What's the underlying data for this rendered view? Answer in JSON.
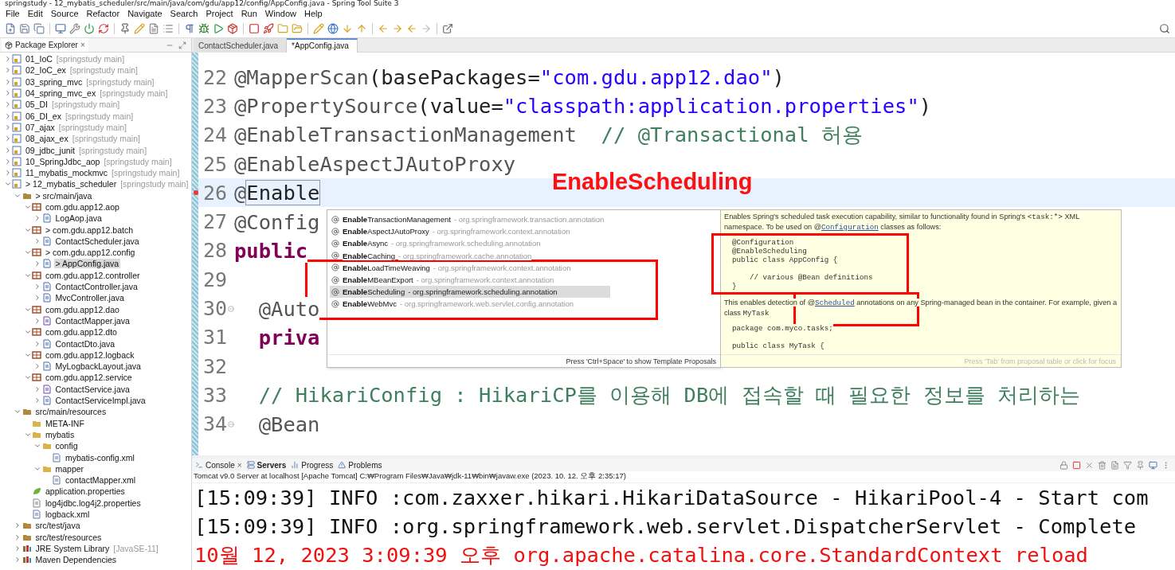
{
  "window": {
    "title": "springstudy - 12_mybatis_scheduler/src/main/java/com/gdu/app12/config/AppConfig.java - Spring Tool Suite 3"
  },
  "menu": [
    "File",
    "Edit",
    "Source",
    "Refactor",
    "Navigate",
    "Search",
    "Project",
    "Run",
    "Window",
    "Help"
  ],
  "explorer": {
    "tab": {
      "label": "Package Explorer",
      "close": "×"
    },
    "tree": [
      {
        "label": "01_IoC",
        "suffix": "[springstudy main]",
        "kind": "project",
        "expanded": false,
        "selected": false
      },
      {
        "label": "02_IoC_ex",
        "suffix": "[springstudy main]",
        "kind": "project",
        "expanded": false,
        "selected": false
      },
      {
        "label": "03_spring_mvc",
        "suffix": "[springstudy main]",
        "kind": "project",
        "expanded": false,
        "selected": false
      },
      {
        "label": "04_spring_mvc_ex",
        "suffix": "[springstudy main]",
        "kind": "project",
        "expanded": false,
        "selected": false
      },
      {
        "label": "05_DI",
        "suffix": "[springstudy main]",
        "kind": "project",
        "expanded": false,
        "selected": false
      },
      {
        "label": "06_DI_ex",
        "suffix": "[springstudy main]",
        "kind": "project",
        "expanded": false,
        "selected": false
      },
      {
        "label": "07_ajax",
        "suffix": "[springstudy main]",
        "kind": "project",
        "expanded": false,
        "selected": false
      },
      {
        "label": "08_ajax_ex",
        "suffix": "[springstudy main]",
        "kind": "project",
        "expanded": false,
        "selected": false
      },
      {
        "label": "09_jdbc_junit",
        "suffix": "[springstudy main]",
        "kind": "project",
        "expanded": false,
        "selected": false
      },
      {
        "label": "10_SpringJdbc_aop",
        "suffix": "[springstudy main]",
        "kind": "project",
        "expanded": false,
        "selected": false
      },
      {
        "label": "11_mybatis_mockmvc",
        "suffix": "[springstudy main]",
        "kind": "project",
        "expanded": false,
        "selected": false
      },
      {
        "label": "12_mybatis_scheduler",
        "decoration": ">",
        "suffix": "[springstudy main]",
        "kind": "project",
        "expanded": true,
        "selected": false,
        "children": [
          {
            "label": "src/main/java",
            "decoration": ">",
            "kind": "source",
            "expanded": true,
            "selected": false,
            "children": [
              {
                "label": "com.gdu.app12.aop",
                "kind": "package",
                "expanded": true,
                "selected": false,
                "children": [
                  {
                    "label": "LogAop.java",
                    "kind": "java",
                    "expanded": false,
                    "selected": false
                  }
                ]
              },
              {
                "label": "com.gdu.app12.batch",
                "decoration": ">",
                "kind": "package",
                "expanded": true,
                "selected": false,
                "children": [
                  {
                    "label": "ContactScheduler.java",
                    "kind": "java",
                    "expanded": false,
                    "selected": false
                  }
                ]
              },
              {
                "label": "com.gdu.app12.config",
                "decoration": ">",
                "kind": "package",
                "expanded": true,
                "selected": false,
                "children": [
                  {
                    "label": "AppConfig.java",
                    "decoration": ">",
                    "kind": "java",
                    "expanded": false,
                    "selected": true
                  }
                ]
              },
              {
                "label": "com.gdu.app12.controller",
                "kind": "package",
                "expanded": true,
                "selected": false,
                "children": [
                  {
                    "label": "ContactController.java",
                    "kind": "java",
                    "expanded": false,
                    "selected": false
                  },
                  {
                    "label": "MvcController.java",
                    "kind": "java",
                    "expanded": false,
                    "selected": false
                  }
                ]
              },
              {
                "label": "com.gdu.app12.dao",
                "kind": "package",
                "expanded": true,
                "selected": false,
                "children": [
                  {
                    "label": "ContactMapper.java",
                    "kind": "interface",
                    "expanded": false,
                    "selected": false
                  }
                ]
              },
              {
                "label": "com.gdu.app12.dto",
                "kind": "package",
                "expanded": true,
                "selected": false,
                "children": [
                  {
                    "label": "ContactDto.java",
                    "kind": "java",
                    "expanded": false,
                    "selected": false
                  }
                ]
              },
              {
                "label": "com.gdu.app12.logback",
                "kind": "package",
                "expanded": true,
                "selected": false,
                "children": [
                  {
                    "label": "MyLogbackLayout.java",
                    "kind": "java",
                    "expanded": false,
                    "selected": false
                  }
                ]
              },
              {
                "label": "com.gdu.app12.service",
                "kind": "package",
                "expanded": true,
                "selected": false,
                "children": [
                  {
                    "label": "ContactService.java",
                    "kind": "interface",
                    "expanded": false,
                    "selected": false
                  },
                  {
                    "label": "ContactServiceImpl.java",
                    "kind": "java",
                    "expanded": false,
                    "selected": false
                  }
                ]
              }
            ]
          },
          {
            "label": "src/main/resources",
            "kind": "source",
            "expanded": true,
            "selected": false,
            "children": [
              {
                "label": "META-INF",
                "kind": "folder",
                "selected": false
              },
              {
                "label": "mybatis",
                "kind": "folder",
                "expanded": true,
                "selected": false,
                "children": [
                  {
                    "label": "config",
                    "kind": "folder",
                    "expanded": true,
                    "selected": false,
                    "children": [
                      {
                        "label": "mybatis-config.xml",
                        "kind": "xml",
                        "selected": false
                      }
                    ]
                  },
                  {
                    "label": "mapper",
                    "kind": "folder",
                    "expanded": true,
                    "selected": false,
                    "children": [
                      {
                        "label": "contactMapper.xml",
                        "kind": "xml",
                        "selected": false
                      }
                    ]
                  }
                ]
              },
              {
                "label": "application.properties",
                "kind": "spring",
                "selected": false
              },
              {
                "label": "log4jdbc.log4j2.properties",
                "kind": "text",
                "selected": false
              },
              {
                "label": "logback.xml",
                "kind": "xml",
                "selected": false
              }
            ]
          },
          {
            "label": "src/test/java",
            "kind": "source",
            "expanded": false,
            "selected": false
          },
          {
            "label": "src/test/resources",
            "kind": "source",
            "expanded": false,
            "selected": false
          },
          {
            "label": "JRE System Library",
            "suffix": "[JavaSE-11]",
            "kind": "library",
            "expanded": false,
            "selected": false
          },
          {
            "label": "Maven Dependencies",
            "kind": "library",
            "expanded": false,
            "selected": false
          }
        ]
      }
    ]
  },
  "editor": {
    "tabs": [
      {
        "label": "ContactScheduler.java",
        "selected": false
      },
      {
        "label": "*AppConfig.java",
        "selected": true
      }
    ],
    "lines": [
      {
        "number": "22",
        "current": false,
        "error": false,
        "foldable": false,
        "tokens": [
          {
            "text": "@MapperScan",
            "kind": "annotation"
          },
          {
            "text": "(basePackages=",
            "kind": "plain"
          },
          {
            "text": "\"com.gdu.app12.dao\"",
            "kind": "string"
          },
          {
            "text": ")",
            "kind": "plain"
          }
        ]
      },
      {
        "number": "23",
        "current": false,
        "error": false,
        "foldable": false,
        "tokens": [
          {
            "text": "@PropertySource",
            "kind": "annotation"
          },
          {
            "text": "(value=",
            "kind": "plain"
          },
          {
            "text": "\"classpath:application.properties\"",
            "kind": "string"
          },
          {
            "text": ")",
            "kind": "plain"
          }
        ]
      },
      {
        "number": "24",
        "current": false,
        "error": false,
        "foldable": false,
        "tokens": [
          {
            "text": "@EnableTransactionManagement  ",
            "kind": "annotation"
          },
          {
            "text": "// @Transactional 허용",
            "kind": "comment"
          }
        ]
      },
      {
        "number": "25",
        "current": false,
        "error": false,
        "foldable": false,
        "tokens": [
          {
            "text": "@EnableAspectJAutoProxy",
            "kind": "annotation"
          }
        ]
      },
      {
        "number": "26",
        "current": true,
        "error": true,
        "foldable": false,
        "tokens": [
          {
            "text": "@",
            "kind": "annotation"
          },
          {
            "text": "Enable",
            "kind": "linked"
          }
        ]
      },
      {
        "number": "27",
        "current": false,
        "error": false,
        "foldable": false,
        "tokens": [
          {
            "text": "@Config",
            "kind": "annotation"
          }
        ]
      },
      {
        "number": "28",
        "current": false,
        "error": false,
        "foldable": false,
        "tokens": [
          {
            "text": "public",
            "kind": "keyword"
          }
        ]
      },
      {
        "number": "29",
        "current": false,
        "error": false,
        "foldable": false
      },
      {
        "number": "30",
        "current": false,
        "error": false,
        "foldable": true,
        "tokens": [
          {
            "text": "  @Auto",
            "kind": "annotation"
          }
        ]
      },
      {
        "number": "31",
        "current": false,
        "error": false,
        "foldable": false,
        "tokens": [
          {
            "text": "  priva",
            "kind": "keyword"
          }
        ]
      },
      {
        "number": "32",
        "current": false,
        "error": false,
        "foldable": false
      },
      {
        "number": "33",
        "current": false,
        "error": false,
        "foldable": false,
        "tokens": [
          {
            "text": "  // HikariConfig : HikariCP를 이용해 DB에 접속할 때 필요한 정보를 처리하는",
            "kind": "comment"
          }
        ]
      },
      {
        "number": "34",
        "current": false,
        "error": false,
        "foldable": true,
        "tokens": [
          {
            "text": "  @Bean",
            "kind": "annotation"
          }
        ]
      }
    ],
    "proposals": [
      {
        "name": "**Enable**TransactionManagement",
        "package": "- org.springframework.transaction.annotation",
        "selected": false
      },
      {
        "name": "**Enable**AspectJAutoProxy",
        "package": "- org.springframework.context.annotation",
        "selected": false
      },
      {
        "name": "**Enable**Async",
        "package": "- org.springframework.scheduling.annotation",
        "selected": false
      },
      {
        "name": "**Enable**Caching",
        "package": "- org.springframework.cache.annotation",
        "selected": false
      },
      {
        "name": "**Enable**LoadTimeWeaving",
        "package": "- org.springframework.context.annotation",
        "selected": false
      },
      {
        "name": "**Enable**MBeanExport",
        "package": "- org.springframework.context.annotation",
        "selected": false
      },
      {
        "name": "**Enable**Scheduling",
        "package": "- org.springframework.scheduling.annotation",
        "selected": true
      },
      {
        "name": "**Enable**WebMvc",
        "package": "- org.springframework.web.servlet.config.annotation",
        "selected": false
      }
    ],
    "proposals_footer": "Press 'Ctrl+Space' to show Template Proposals",
    "doc": {
      "blocks": [
        {
          "kind": "paragraph",
          "segments": [
            {
              "kind": "plain",
              "text": "Enables Spring's scheduled task execution capability, similar to functionality found in Spring's "
            },
            {
              "kind": "code",
              "text": "<task:*>"
            },
            {
              "kind": "plain",
              "text": " XML namespace. To be used on @"
            },
            {
              "kind": "link",
              "text": "Configuration"
            },
            {
              "kind": "plain",
              "text": " classes as follows:"
            }
          ]
        },
        {
          "kind": "code",
          "groups": [
            [
              "@Configuration",
              "@EnableScheduling",
              "public class AppConfig {"
            ],
            [
              "    // various @Bean definitions",
              "}"
            ]
          ]
        },
        {
          "kind": "paragraph",
          "segments": [
            {
              "kind": "plain",
              "text": "This enables detection of @"
            },
            {
              "kind": "link",
              "text": "Scheduled"
            },
            {
              "kind": "plain",
              "text": " annotations on any Spring-managed bean in the container. For example, given a class "
            },
            {
              "kind": "code",
              "text": "MyTask"
            }
          ]
        },
        {
          "kind": "code",
          "groups": [
            [
              "package com.myco.tasks;"
            ],
            [
              "public class MyTask {"
            ]
          ]
        }
      ],
      "footer": "Press 'Tab' from proposal table or click for focus"
    },
    "overlay_label": "EnableScheduling"
  },
  "console": {
    "tabs": [
      {
        "label": "Console",
        "close": "×",
        "selected": false,
        "kind": "console"
      },
      {
        "label": "Servers",
        "selected": true,
        "kind": "servers"
      },
      {
        "label": "Progress",
        "selected": false,
        "kind": "progress"
      },
      {
        "label": "Problems",
        "selected": false,
        "kind": "problems"
      }
    ],
    "info": "Tomcat v9.0 Server at localhost [Apache Tomcat] C:₩Program Files₩Java₩jdk-11₩bin₩javaw.exe  (2023. 10. 12. 오후 2:35:17)",
    "lines": [
      {
        "text": "[15:09:39] INFO :com.zaxxer.hikari.HikariDataSource - HikariPool-4 - Start com",
        "color": "#111111"
      },
      {
        "text": "[15:09:39] INFO :org.springframework.web.servlet.DispatcherServlet - Complete",
        "color": "#111111"
      },
      {
        "text": "10월 12, 2023 3:09:39 오후 org.apache.catalina.core.StandardContext reload",
        "color": "#ee1111"
      }
    ]
  }
}
